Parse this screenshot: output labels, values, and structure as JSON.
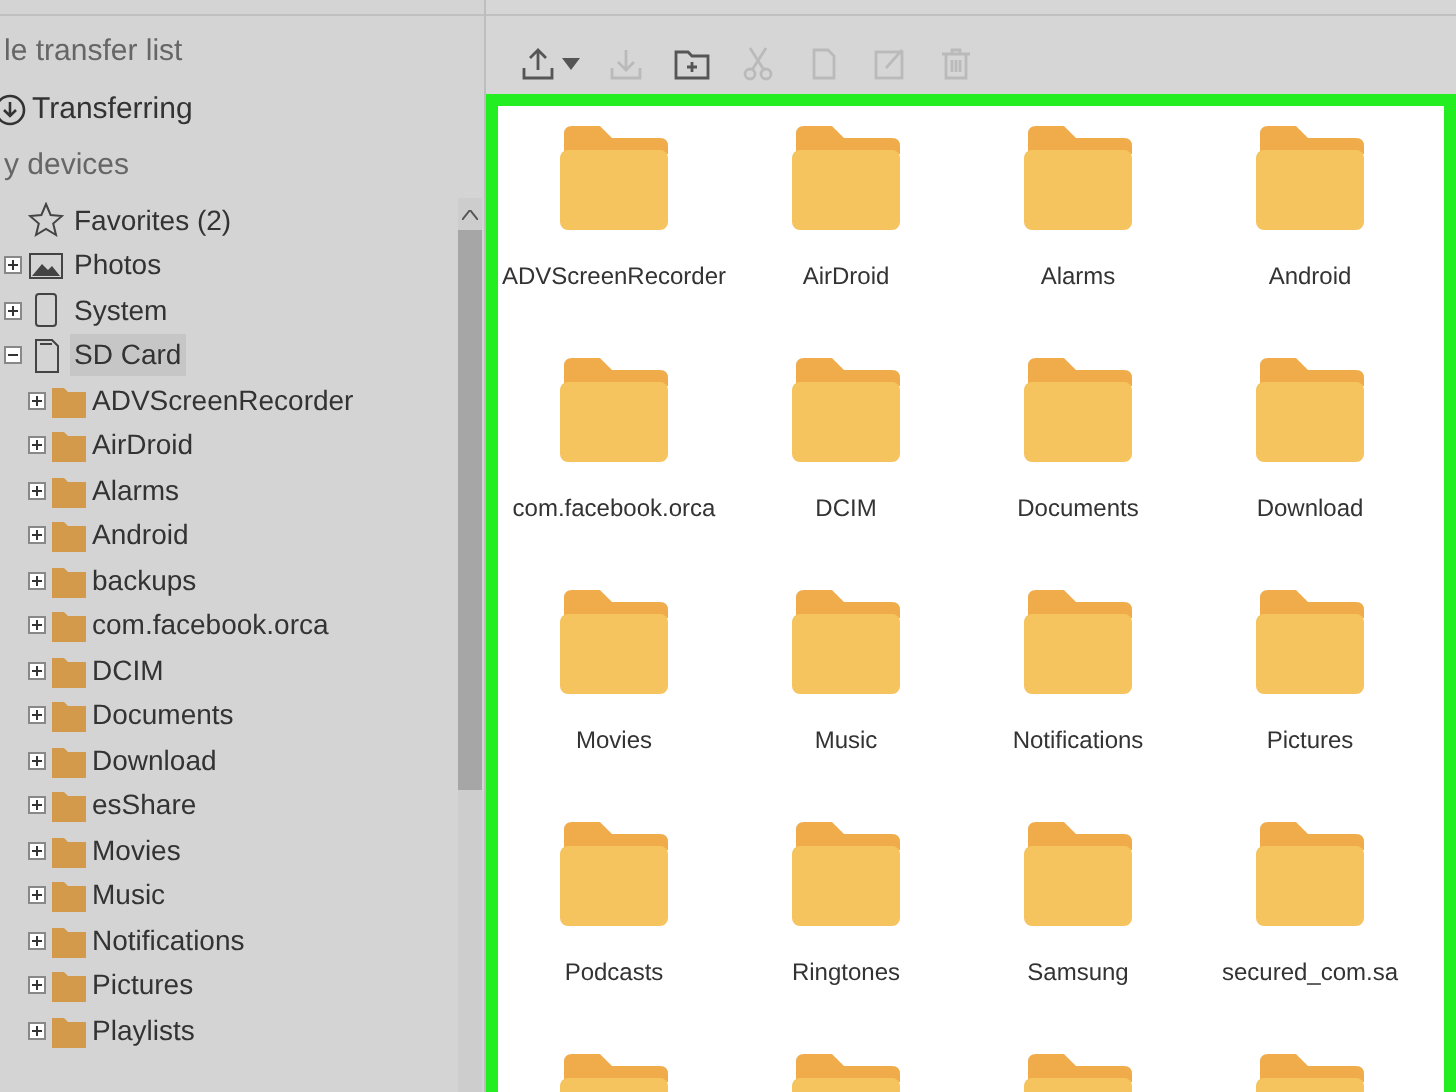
{
  "sidebar": {
    "section_1": "le transfer list",
    "transfer_item": "Transferring",
    "section_2": "y devices",
    "tree": [
      {
        "kind": "favorites",
        "label": "Favorites (2)",
        "selected": false
      },
      {
        "kind": "photos",
        "label": "Photos",
        "selected": false,
        "expanded": false
      },
      {
        "kind": "system",
        "label": "System",
        "selected": false,
        "expanded": false
      },
      {
        "kind": "sdcard",
        "label": "SD Card",
        "selected": true,
        "expanded": true,
        "children": [
          {
            "label": "ADVScreenRecorder"
          },
          {
            "label": "AirDroid"
          },
          {
            "label": "Alarms"
          },
          {
            "label": "Android"
          },
          {
            "label": "backups"
          },
          {
            "label": "com.facebook.orca"
          },
          {
            "label": "DCIM"
          },
          {
            "label": "Documents"
          },
          {
            "label": "Download"
          },
          {
            "label": "esShare"
          },
          {
            "label": "Movies"
          },
          {
            "label": "Music"
          },
          {
            "label": "Notifications"
          },
          {
            "label": "Pictures"
          },
          {
            "label": "Playlists"
          }
        ]
      }
    ]
  },
  "toolbar": [
    {
      "kind": "upload",
      "disabled": false
    },
    {
      "kind": "download",
      "disabled": true
    },
    {
      "kind": "new-folder",
      "disabled": false
    },
    {
      "kind": "cut",
      "disabled": true
    },
    {
      "kind": "copy",
      "disabled": true
    },
    {
      "kind": "rename",
      "disabled": true
    },
    {
      "kind": "delete",
      "disabled": true
    }
  ],
  "grid": [
    {
      "kind": "folder",
      "label": "ADVScreenRecorder"
    },
    {
      "kind": "folder",
      "label": "AirDroid"
    },
    {
      "kind": "folder",
      "label": "Alarms"
    },
    {
      "kind": "folder",
      "label": "Android"
    },
    {
      "kind": "folder",
      "label": "com.facebook.orca"
    },
    {
      "kind": "folder",
      "label": "DCIM"
    },
    {
      "kind": "folder",
      "label": "Documents"
    },
    {
      "kind": "folder",
      "label": "Download"
    },
    {
      "kind": "folder",
      "label": "Movies"
    },
    {
      "kind": "folder",
      "label": "Music"
    },
    {
      "kind": "folder",
      "label": "Notifications"
    },
    {
      "kind": "folder",
      "label": "Pictures"
    },
    {
      "kind": "folder",
      "label": "Podcasts"
    },
    {
      "kind": "folder",
      "label": "Ringtones"
    },
    {
      "kind": "folder",
      "label": "Samsung"
    },
    {
      "kind": "folder",
      "label": "secured_com.sa"
    },
    {
      "kind": "folder"
    },
    {
      "kind": "folder"
    },
    {
      "kind": "folder"
    },
    {
      "kind": "folder"
    }
  ]
}
